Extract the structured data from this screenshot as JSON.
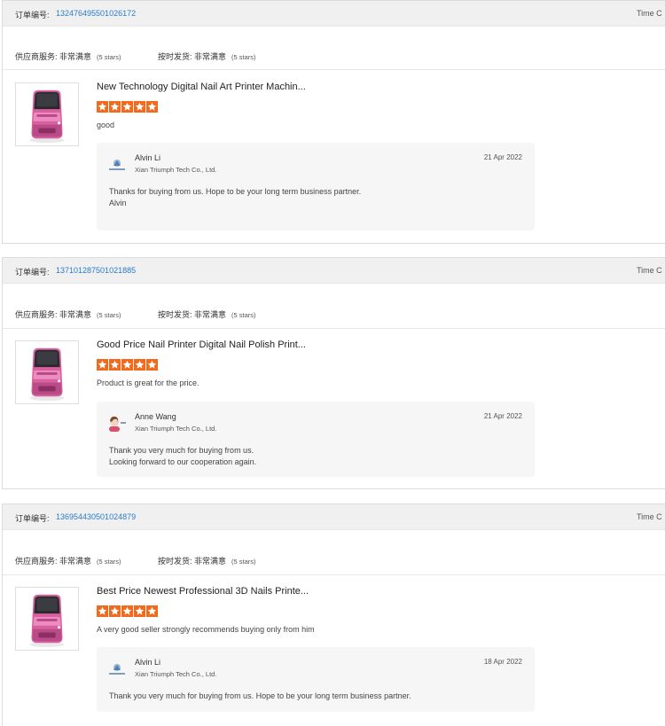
{
  "labels": {
    "order_no_label": "订单编号:",
    "time_col": "Time C",
    "supplier_service": "供应商服务: 非常满意",
    "ontime_shipping": "按时发货: 非常满意",
    "five_stars": "(5 stars)"
  },
  "colors": {
    "star": "#f26a1b",
    "link": "#2a7cc7",
    "header_bg": "#f0f0f0",
    "reply_bg": "#f6f6f7",
    "product_pink": "#e07ab3"
  },
  "orders": [
    {
      "order_no": "132476495501026172",
      "product_title": "New Technology Digital Nail Art Printer Machin...",
      "rating": 5,
      "comment": "good",
      "reply": {
        "name": "Alvin Li",
        "company": "Xian Triumph Tech Co., Ltd.",
        "date": "21 Apr 2022",
        "line1": "Thanks for buying from us. Hope to be your long term business partner.",
        "line2": "Alvin"
      }
    },
    {
      "order_no": "137101287501021885",
      "product_title": "Good Price Nail Printer Digital Nail Polish Print...",
      "rating": 5,
      "comment": "Product is great for the price.",
      "reply": {
        "name": "Anne Wang",
        "company": "Xian Triumph Tech Co., Ltd.",
        "date": "21 Apr 2022",
        "line1": "Thank you very much for buying from us.",
        "line2": "Looking forward to our cooperation again."
      }
    },
    {
      "order_no": "136954430501024879",
      "product_title": "Best Price Newest Professional 3D Nails Printe...",
      "rating": 5,
      "comment": "A very good seller strongly recommends buying only from him",
      "reply": {
        "name": "Alvin Li",
        "company": "Xian Triumph Tech Co., Ltd.",
        "date": "18 Apr 2022",
        "line1": "Thank you very much for buying from us. Hope to  be your long term business partner.",
        "line2": ""
      }
    }
  ]
}
